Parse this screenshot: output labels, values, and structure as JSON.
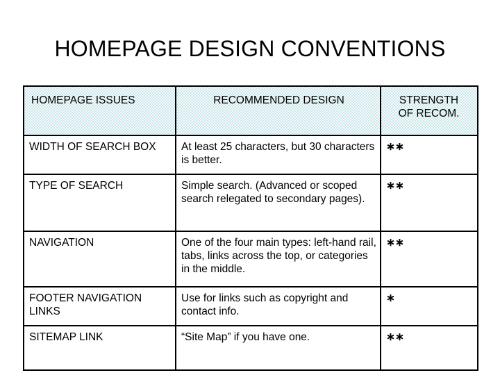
{
  "slide": {
    "title": "HOMEPAGE DESIGN CONVENTIONS",
    "background_color": "#ffffff",
    "text_color": "#000000"
  },
  "table": {
    "header_background_color": "#cbe7ec",
    "border_color": "#000000",
    "columns": [
      {
        "key": "issue",
        "label": "HOMEPAGE ISSUES"
      },
      {
        "key": "design",
        "label": "RECOMMENDED DESIGN"
      },
      {
        "key": "strength",
        "label": "STRENGTH OF RECOM."
      }
    ],
    "header": {
      "issues": "HOMEPAGE ISSUES",
      "design": "RECOMMENDED DESIGN",
      "strength_line1": "STRENGTH",
      "strength_line2": "OF RECOM."
    },
    "rows": [
      {
        "issue": "WIDTH OF SEARCH BOX",
        "design": "At least 25 characters, but 30 characters is better.",
        "strength": "∗∗",
        "strength_count": 2
      },
      {
        "issue": "TYPE OF SEARCH",
        "design": "Simple search. (Advanced or scoped search relegated to secondary pages).",
        "strength": "∗∗",
        "strength_count": 2
      },
      {
        "issue": "NAVIGATION",
        "design": "One of the four main types: left-hand rail, tabs, links across the top, or categories in the middle.",
        "strength": "∗∗",
        "strength_count": 2
      },
      {
        "issue": "FOOTER NAVIGATION LINKS",
        "design": "Use for links such as copyright and contact info.",
        "strength": "∗",
        "strength_count": 1
      },
      {
        "issue": "SITEMAP LINK",
        "design": "“Site Map” if you have one.",
        "strength": "∗∗",
        "strength_count": 2
      }
    ]
  }
}
